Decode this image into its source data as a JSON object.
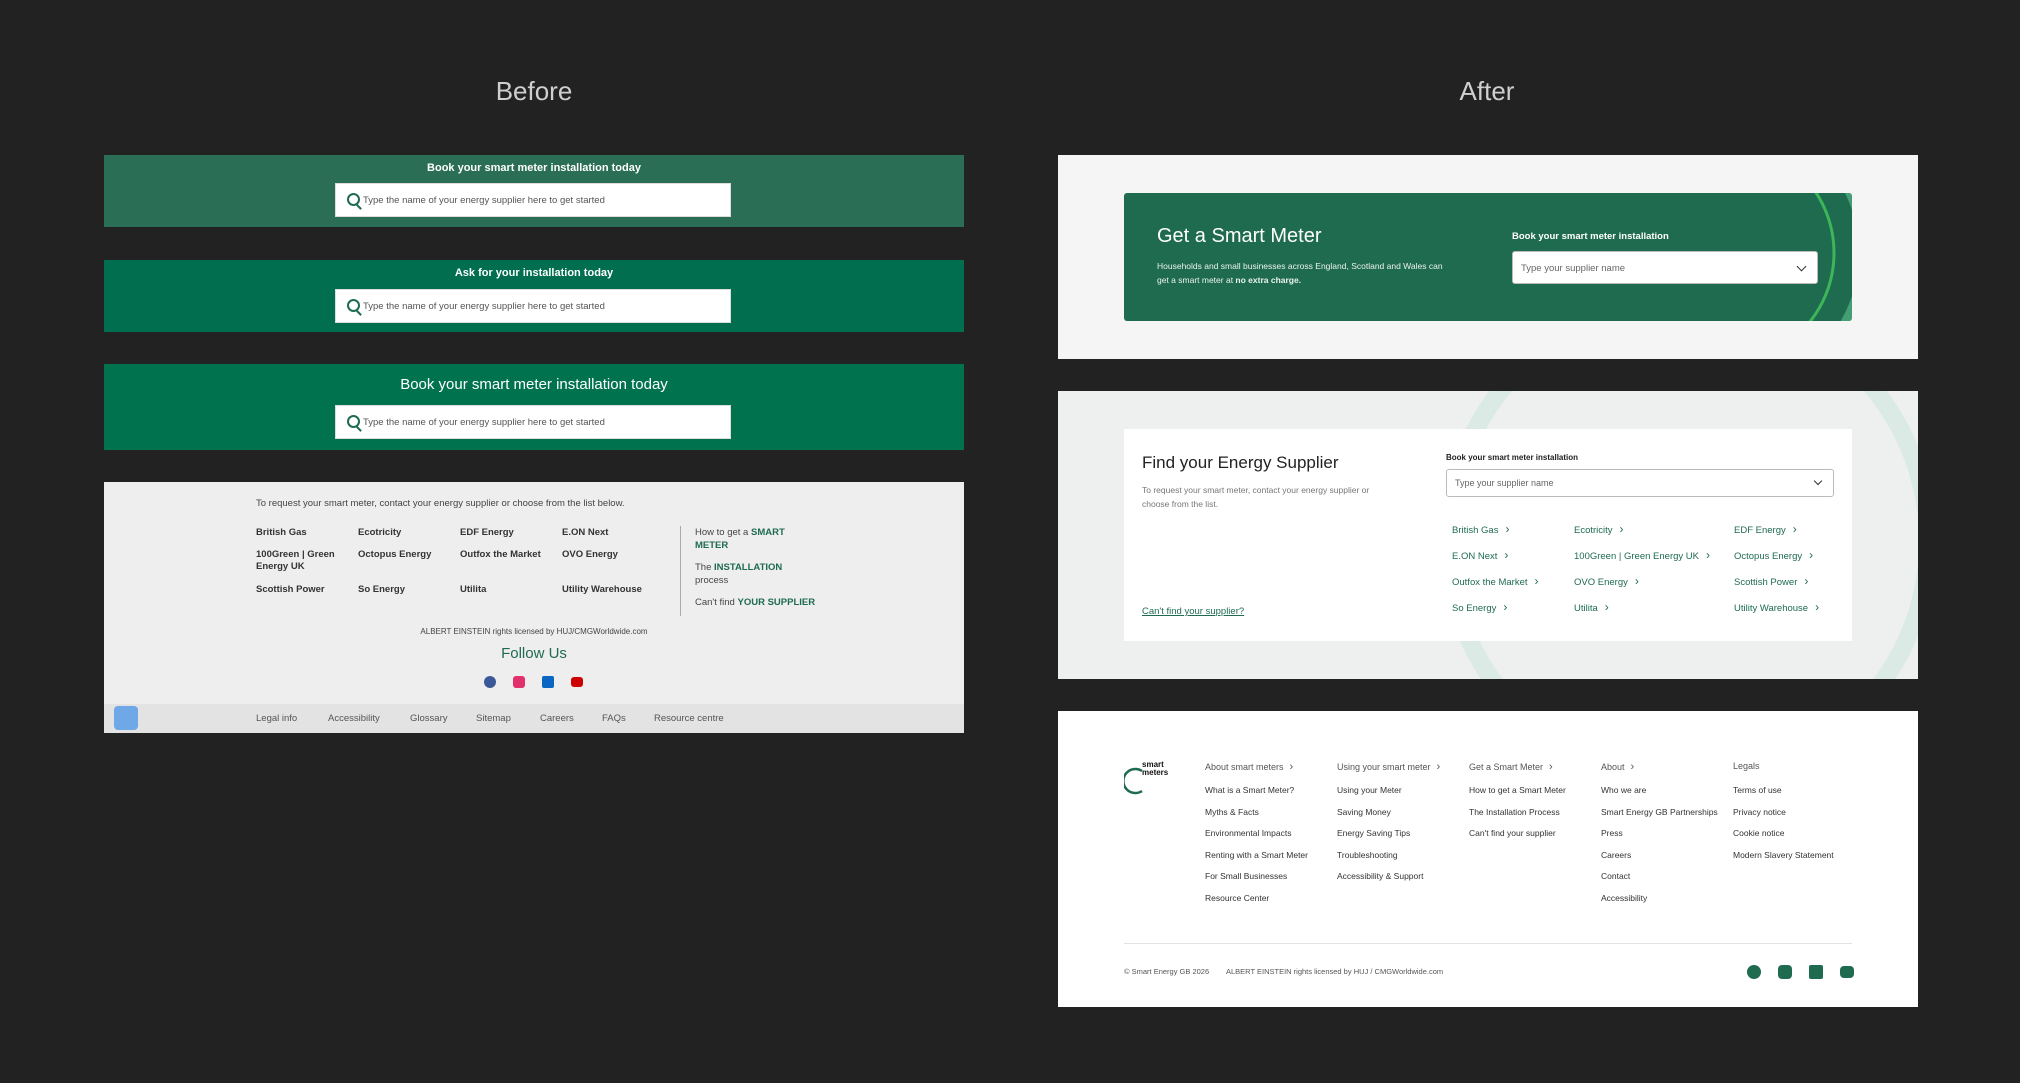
{
  "labels": {
    "before": "Before",
    "after": "After"
  },
  "before": {
    "banner1": {
      "title": "Book your smart meter installation today",
      "placeholder": "Type the name of your energy supplier here to get started"
    },
    "banner2": {
      "title": "Ask for your installation today",
      "placeholder": "Type the name of your energy supplier here to get started"
    },
    "banner3": {
      "title": "Book your smart meter installation today",
      "placeholder": "Type the name of your energy supplier here to get started"
    },
    "footer": {
      "intro": "To request your smart meter, contact your energy supplier or choose from the list below.",
      "suppliers": [
        "British Gas",
        "Ecotricity",
        "EDF Energy",
        "E.ON Next",
        "100Green | Green Energy UK",
        "Octopus Energy",
        "Outfox the Market",
        "OVO Energy",
        "Scottish Power",
        "So Energy",
        "Utilita",
        "Utility Warehouse"
      ],
      "links": [
        {
          "pre": "How to get a ",
          "bold": "SMART METER",
          "post": ""
        },
        {
          "pre": "The ",
          "bold": "INSTALLATION",
          "post": " process"
        },
        {
          "pre": "Can't find ",
          "bold": "YOUR SUPPLIER",
          "post": ""
        }
      ],
      "license": "ALBERT EINSTEIN rights licensed by HUJ/CMGWorldwide.com",
      "follow": "Follow Us",
      "legal_links": [
        "Legal info",
        "Accessibility",
        "Glossary",
        "Sitemap",
        "Careers",
        "FAQs",
        "Resource centre"
      ]
    }
  },
  "after": {
    "hero": {
      "title": "Get a Smart Meter",
      "desc1": "Households and small businesses across England, Scotland and Wales can",
      "desc2_pre": "get a smart meter at ",
      "desc2_bold": "no extra charge.",
      "select_label": "Book your smart meter installation",
      "select_placeholder": "Type your supplier name"
    },
    "finder": {
      "title": "Find your Energy Supplier",
      "desc1": "To request your smart meter, contact your energy supplier or",
      "desc2": "choose from the list.",
      "cant_find": "Can't find your supplier?",
      "select_label": "Book your smart meter installation",
      "select_placeholder": "Type your supplier name",
      "suppliers": [
        "British Gas",
        "Ecotricity",
        "EDF Energy",
        "E.ON Next",
        "100Green | Green Energy UK",
        "Octopus Energy",
        "Outfox the Market",
        "OVO Energy",
        "Scottish Power",
        "So Energy",
        "Utilita",
        "Utility Warehouse"
      ]
    },
    "footer": {
      "logo": "smart meters",
      "columns": [
        {
          "heading": "About smart meters",
          "items": [
            "What is a Smart Meter?",
            "Myths & Facts",
            "Environmental Impacts",
            "Renting with a Smart Meter",
            "For Small Businesses",
            "Resource Center"
          ]
        },
        {
          "heading": "Using your smart meter",
          "items": [
            "Using your Meter",
            "Saving Money",
            "Energy Saving Tips",
            "Troubleshooting",
            "Accessibility & Support"
          ]
        },
        {
          "heading": "Get a Smart Meter",
          "items": [
            "How to get a Smart Meter",
            "The Installation Process",
            "Can't find your supplier"
          ]
        },
        {
          "heading": "About",
          "items": [
            "Who we are",
            "Smart Energy GB Partnerships",
            "Press",
            "Careers",
            "Contact",
            "Accessibility"
          ]
        },
        {
          "heading": "Legals",
          "items": [
            "Terms of use",
            "Privacy notice",
            "Cookie notice",
            "Modern Slavery Statement"
          ]
        }
      ],
      "copyright": "© Smart Energy GB 2026",
      "license": "ALBERT EINSTEIN rights licensed by HUJ / CMGWorldwide.com"
    }
  },
  "colors": {
    "background": "#222222",
    "green": "#1f6b50",
    "bright_green": "#00734e"
  },
  "icons": [
    "search-icon",
    "facebook-icon",
    "instagram-icon",
    "linkedin-icon",
    "youtube-icon",
    "chevron-down-icon",
    "shield-icon"
  ]
}
